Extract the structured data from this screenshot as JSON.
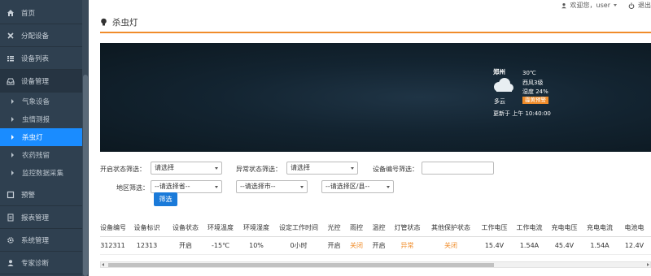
{
  "sidebar": {
    "items": [
      {
        "label": "首页",
        "icon": "home-icon"
      },
      {
        "label": "分配设备",
        "icon": "wrench-icon"
      },
      {
        "label": "设备列表",
        "icon": "list-icon"
      },
      {
        "label": "设备管理",
        "icon": "inbox-icon"
      },
      {
        "label": "气象设备"
      },
      {
        "label": "虫情测报"
      },
      {
        "label": "杀虫灯"
      },
      {
        "label": "农药残留"
      },
      {
        "label": "监控数据采集"
      },
      {
        "label": "预警",
        "icon": "alert-icon"
      },
      {
        "label": "报表管理",
        "icon": "report-icon"
      },
      {
        "label": "系统管理",
        "icon": "gear-icon"
      },
      {
        "label": "专家诊断",
        "icon": "user-icon"
      }
    ]
  },
  "topbar": {
    "greeting": "欢迎您，user",
    "logout": "退出"
  },
  "page": {
    "title": "杀虫灯"
  },
  "weather": {
    "city": "郑州",
    "temp": "30℃",
    "wind": "西风3级",
    "humidity": "湿度 24%",
    "badge": "霾黄预警",
    "desc": "多云",
    "updated": "更新于 上午 10:40:00"
  },
  "filters": {
    "switch_label": "开启状态筛选：",
    "switch_value": "请选择",
    "abnormal_label": "异常状态筛选：",
    "abnormal_value": "请选择",
    "device_no_label": "设备编号筛选：",
    "device_no_value": "",
    "region_label": "地区筛选：",
    "province": "--请选择省--",
    "city": "--请选择市--",
    "district": "--请选择区/县--",
    "submit": "筛选"
  },
  "table": {
    "headers": [
      "设备编号",
      "设备标识",
      "设备状态",
      "环境温度",
      "环境湿度",
      "设定工作时间",
      "光控",
      "雨控",
      "温控",
      "灯管状态",
      "其他保护状态",
      "工作电压",
      "工作电流",
      "充电电压",
      "充电电流",
      "电池电"
    ],
    "rows": [
      [
        "312311",
        "12313",
        "开启",
        "-15℃",
        "10%",
        "0小时",
        "开启",
        "关闭",
        "开启",
        "异常",
        "关闭",
        "15.4V",
        "1.54A",
        "45.4V",
        "1.54A",
        "12.4V"
      ]
    ]
  },
  "colors": {
    "accent": "#f08c2a",
    "primary": "#1a8cff",
    "sidebar": "#2f4050"
  }
}
